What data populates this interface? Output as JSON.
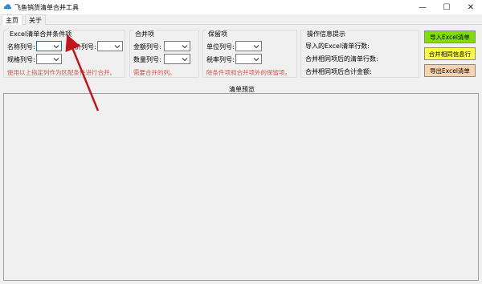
{
  "window": {
    "title": "飞鱼销货清单合并工具",
    "minimize_glyph": "—",
    "maximize_glyph": "☐",
    "close_glyph": "✕",
    "icon": "app-cloud-icon"
  },
  "tabs": [
    "主页",
    "关于"
  ],
  "group_conditions": {
    "title": "Excel清单合并条件项",
    "name_label": "名称列号:",
    "price_label": "单价列号:",
    "spec_label": "规格列号:",
    "hint": "使用以上指定列作为区配条件进行合并。"
  },
  "group_merge": {
    "title": "合并项",
    "amount_label": "金额列号:",
    "quantity_label": "数量列号:",
    "hint": "需要合并的列。"
  },
  "group_keep": {
    "title": "保留项",
    "unit_label": "单位列号:",
    "tax_label": "税率列号:",
    "hint": "除条件项和合并项外的保留项。"
  },
  "group_info": {
    "title": "操作信息提示",
    "line1": "导入的Excel清单行数:",
    "line2": "合并相同项后的清单行数:",
    "line3": "合并相同项后合计金额:"
  },
  "buttons": {
    "import": "导入Excel清单",
    "merge": "合并相同信息行",
    "export": "导出Excel清单"
  },
  "colors": {
    "import_bg": "#7fe000",
    "merge_bg": "#ffff3a",
    "export_bg": "#f7d2b0",
    "hint": "#d9534f",
    "arrow": "#c0161c"
  },
  "preview_title": "清单预览"
}
